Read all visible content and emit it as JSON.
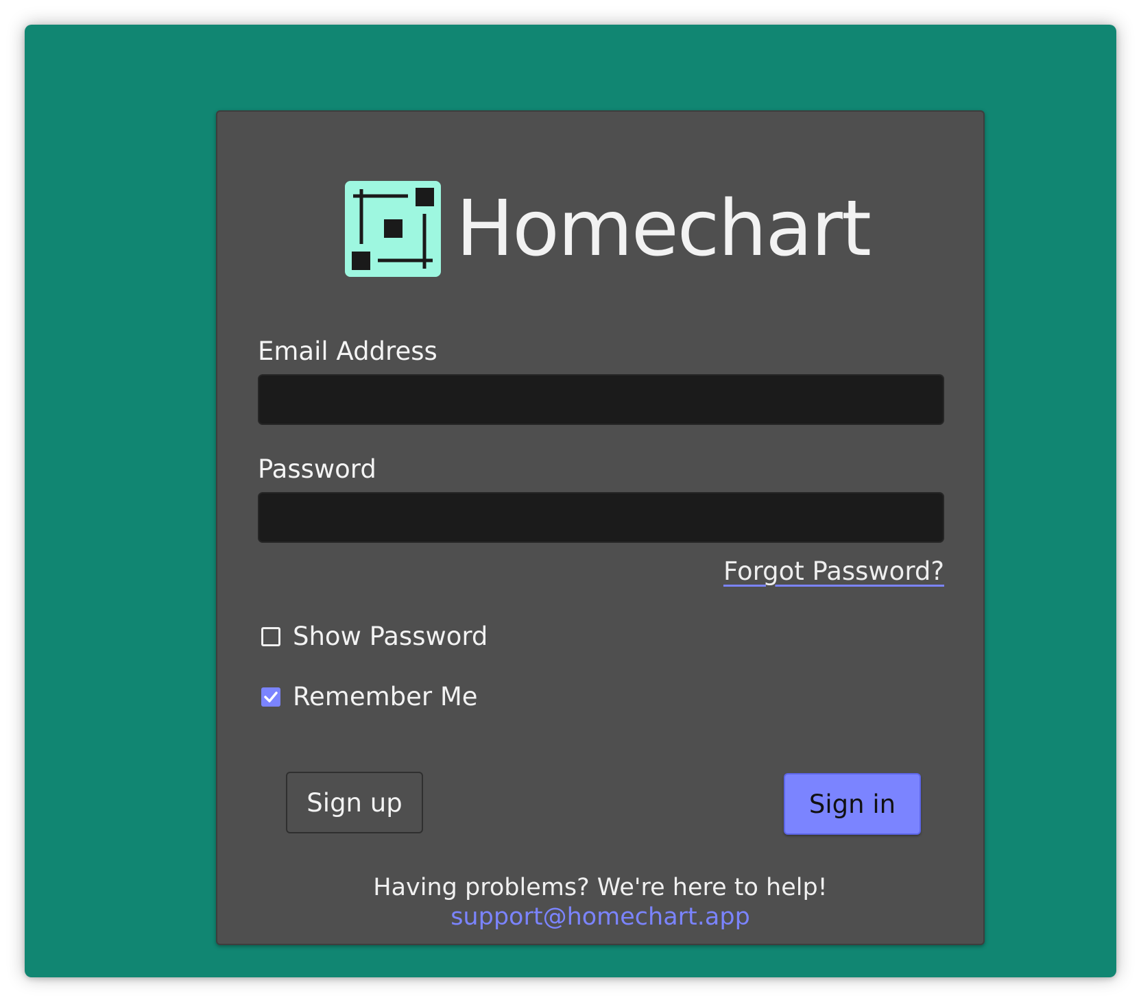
{
  "app": {
    "name": "Homechart",
    "logo_icon": "homechart-logo-icon"
  },
  "colors": {
    "background": "#118672",
    "card": "#4f4f4f",
    "input": "#1b1b1b",
    "accent": "#7b84ff",
    "logo_tile": "#9ef7e0"
  },
  "form": {
    "email": {
      "label": "Email Address",
      "value": "",
      "placeholder": ""
    },
    "password": {
      "label": "Password",
      "value": "",
      "placeholder": ""
    },
    "forgot_password": "Forgot Password?",
    "show_password": {
      "label": "Show Password",
      "checked": false
    },
    "remember_me": {
      "label": "Remember Me",
      "checked": true
    }
  },
  "buttons": {
    "sign_up": "Sign up",
    "sign_in": "Sign in"
  },
  "help": {
    "text": "Having problems? We're here to help!",
    "email": "support@homechart.app"
  }
}
